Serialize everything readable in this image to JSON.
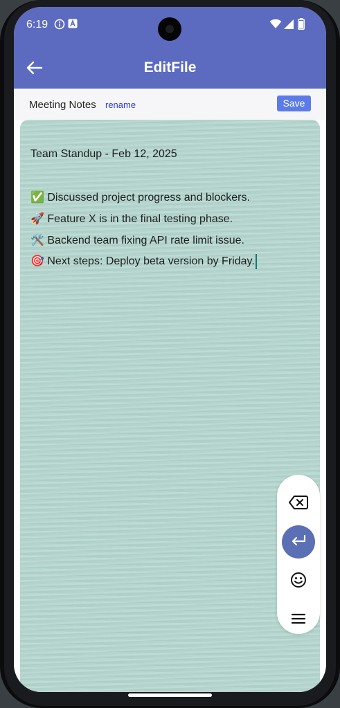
{
  "status_bar": {
    "time": "6:19",
    "icons": [
      "info-icon",
      "a-badge-icon",
      "wifi-icon",
      "signal-icon",
      "battery-icon"
    ]
  },
  "app_bar": {
    "title": "EditFile",
    "back_icon": "arrow-left-icon",
    "color": "#5c6bc0"
  },
  "file_bar": {
    "file_name": "Meeting Notes",
    "rename_label": "rename",
    "save_label": "Save"
  },
  "editor": {
    "lines": [
      "Team Standup - Feb 12, 2025",
      "",
      "✅ Discussed project progress and blockers.",
      "🚀 Feature X is in the final testing phase.",
      "🛠️ Backend team fixing API rate limit issue.",
      "🎯 Next steps: Deploy beta version by Friday."
    ],
    "background_color": "#b5d7cf"
  },
  "keyboard_actions": {
    "buttons": [
      "backspace-icon",
      "enter-icon",
      "emoji-icon",
      "menu-icon"
    ],
    "accent": "#5b6fb5"
  }
}
